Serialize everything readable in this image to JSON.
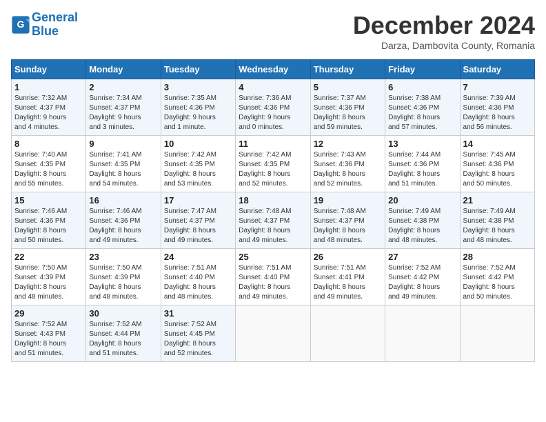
{
  "header": {
    "logo_line1": "General",
    "logo_line2": "Blue",
    "title": "December 2024",
    "subtitle": "Darza, Dambovita County, Romania"
  },
  "weekdays": [
    "Sunday",
    "Monday",
    "Tuesday",
    "Wednesday",
    "Thursday",
    "Friday",
    "Saturday"
  ],
  "weeks": [
    [
      {
        "day": "1",
        "info": "Sunrise: 7:32 AM\nSunset: 4:37 PM\nDaylight: 9 hours\nand 4 minutes."
      },
      {
        "day": "2",
        "info": "Sunrise: 7:34 AM\nSunset: 4:37 PM\nDaylight: 9 hours\nand 3 minutes."
      },
      {
        "day": "3",
        "info": "Sunrise: 7:35 AM\nSunset: 4:36 PM\nDaylight: 9 hours\nand 1 minute."
      },
      {
        "day": "4",
        "info": "Sunrise: 7:36 AM\nSunset: 4:36 PM\nDaylight: 9 hours\nand 0 minutes."
      },
      {
        "day": "5",
        "info": "Sunrise: 7:37 AM\nSunset: 4:36 PM\nDaylight: 8 hours\nand 59 minutes."
      },
      {
        "day": "6",
        "info": "Sunrise: 7:38 AM\nSunset: 4:36 PM\nDaylight: 8 hours\nand 57 minutes."
      },
      {
        "day": "7",
        "info": "Sunrise: 7:39 AM\nSunset: 4:36 PM\nDaylight: 8 hours\nand 56 minutes."
      }
    ],
    [
      {
        "day": "8",
        "info": "Sunrise: 7:40 AM\nSunset: 4:35 PM\nDaylight: 8 hours\nand 55 minutes."
      },
      {
        "day": "9",
        "info": "Sunrise: 7:41 AM\nSunset: 4:35 PM\nDaylight: 8 hours\nand 54 minutes."
      },
      {
        "day": "10",
        "info": "Sunrise: 7:42 AM\nSunset: 4:35 PM\nDaylight: 8 hours\nand 53 minutes."
      },
      {
        "day": "11",
        "info": "Sunrise: 7:42 AM\nSunset: 4:35 PM\nDaylight: 8 hours\nand 52 minutes."
      },
      {
        "day": "12",
        "info": "Sunrise: 7:43 AM\nSunset: 4:36 PM\nDaylight: 8 hours\nand 52 minutes."
      },
      {
        "day": "13",
        "info": "Sunrise: 7:44 AM\nSunset: 4:36 PM\nDaylight: 8 hours\nand 51 minutes."
      },
      {
        "day": "14",
        "info": "Sunrise: 7:45 AM\nSunset: 4:36 PM\nDaylight: 8 hours\nand 50 minutes."
      }
    ],
    [
      {
        "day": "15",
        "info": "Sunrise: 7:46 AM\nSunset: 4:36 PM\nDaylight: 8 hours\nand 50 minutes."
      },
      {
        "day": "16",
        "info": "Sunrise: 7:46 AM\nSunset: 4:36 PM\nDaylight: 8 hours\nand 49 minutes."
      },
      {
        "day": "17",
        "info": "Sunrise: 7:47 AM\nSunset: 4:37 PM\nDaylight: 8 hours\nand 49 minutes."
      },
      {
        "day": "18",
        "info": "Sunrise: 7:48 AM\nSunset: 4:37 PM\nDaylight: 8 hours\nand 49 minutes."
      },
      {
        "day": "19",
        "info": "Sunrise: 7:48 AM\nSunset: 4:37 PM\nDaylight: 8 hours\nand 48 minutes."
      },
      {
        "day": "20",
        "info": "Sunrise: 7:49 AM\nSunset: 4:38 PM\nDaylight: 8 hours\nand 48 minutes."
      },
      {
        "day": "21",
        "info": "Sunrise: 7:49 AM\nSunset: 4:38 PM\nDaylight: 8 hours\nand 48 minutes."
      }
    ],
    [
      {
        "day": "22",
        "info": "Sunrise: 7:50 AM\nSunset: 4:39 PM\nDaylight: 8 hours\nand 48 minutes."
      },
      {
        "day": "23",
        "info": "Sunrise: 7:50 AM\nSunset: 4:39 PM\nDaylight: 8 hours\nand 48 minutes."
      },
      {
        "day": "24",
        "info": "Sunrise: 7:51 AM\nSunset: 4:40 PM\nDaylight: 8 hours\nand 48 minutes."
      },
      {
        "day": "25",
        "info": "Sunrise: 7:51 AM\nSunset: 4:40 PM\nDaylight: 8 hours\nand 49 minutes."
      },
      {
        "day": "26",
        "info": "Sunrise: 7:51 AM\nSunset: 4:41 PM\nDaylight: 8 hours\nand 49 minutes."
      },
      {
        "day": "27",
        "info": "Sunrise: 7:52 AM\nSunset: 4:42 PM\nDaylight: 8 hours\nand 49 minutes."
      },
      {
        "day": "28",
        "info": "Sunrise: 7:52 AM\nSunset: 4:42 PM\nDaylight: 8 hours\nand 50 minutes."
      }
    ],
    [
      {
        "day": "29",
        "info": "Sunrise: 7:52 AM\nSunset: 4:43 PM\nDaylight: 8 hours\nand 51 minutes."
      },
      {
        "day": "30",
        "info": "Sunrise: 7:52 AM\nSunset: 4:44 PM\nDaylight: 8 hours\nand 51 minutes."
      },
      {
        "day": "31",
        "info": "Sunrise: 7:52 AM\nSunset: 4:45 PM\nDaylight: 8 hours\nand 52 minutes."
      },
      {
        "day": "",
        "info": ""
      },
      {
        "day": "",
        "info": ""
      },
      {
        "day": "",
        "info": ""
      },
      {
        "day": "",
        "info": ""
      }
    ]
  ]
}
